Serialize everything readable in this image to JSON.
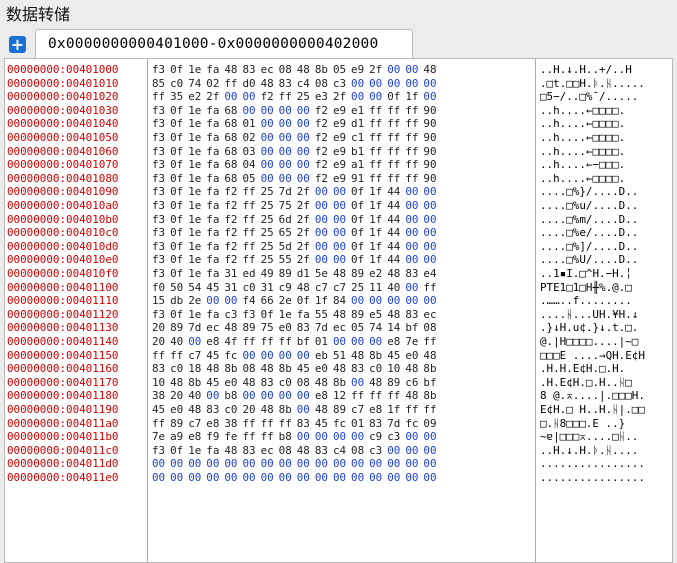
{
  "window": {
    "title": "数据转储"
  },
  "toolbar": {
    "add_icon": "plus-icon"
  },
  "tab": {
    "label": "0x0000000000401000-0x0000000000402000"
  },
  "dump": {
    "rows": [
      {
        "addr": "00000000:00401000",
        "hex": [
          "f3",
          "0f",
          "1e",
          "fa",
          "48",
          "83",
          "ec",
          "08",
          "48",
          "8b",
          "05",
          "e9",
          "2f",
          "00",
          "00",
          "48"
        ],
        "ascii": "..H.↓.H..+/..H"
      },
      {
        "addr": "00000000:00401010",
        "hex": [
          "85",
          "c0",
          "74",
          "02",
          "ff",
          "d0",
          "48",
          "83",
          "c4",
          "08",
          "c3",
          "00",
          "00",
          "00",
          "00",
          "00"
        ],
        "ascii": ".□t.□□H.ᚦ.ᚺ....."
      },
      {
        "addr": "00000000:00401020",
        "hex": [
          "ff",
          "35",
          "e2",
          "2f",
          "00",
          "00",
          "f2",
          "ff",
          "25",
          "e3",
          "2f",
          "00",
          "00",
          "0f",
          "1f",
          "00"
        ],
        "ascii": "□5−/..□%¯/....."
      },
      {
        "addr": "00000000:00401030",
        "hex": [
          "f3",
          "0f",
          "1e",
          "fa",
          "68",
          "00",
          "00",
          "00",
          "00",
          "f2",
          "e9",
          "e1",
          "ff",
          "ff",
          "ff",
          "90"
        ],
        "ascii": "..h....←□□□□."
      },
      {
        "addr": "00000000:00401040",
        "hex": [
          "f3",
          "0f",
          "1e",
          "fa",
          "68",
          "01",
          "00",
          "00",
          "00",
          "f2",
          "e9",
          "d1",
          "ff",
          "ff",
          "ff",
          "90"
        ],
        "ascii": "..h....←□□□□."
      },
      {
        "addr": "00000000:00401050",
        "hex": [
          "f3",
          "0f",
          "1e",
          "fa",
          "68",
          "02",
          "00",
          "00",
          "00",
          "f2",
          "e9",
          "c1",
          "ff",
          "ff",
          "ff",
          "90"
        ],
        "ascii": "..h....←□□□□."
      },
      {
        "addr": "00000000:00401060",
        "hex": [
          "f3",
          "0f",
          "1e",
          "fa",
          "68",
          "03",
          "00",
          "00",
          "00",
          "f2",
          "e9",
          "b1",
          "ff",
          "ff",
          "ff",
          "90"
        ],
        "ascii": "..h....←□□□□."
      },
      {
        "addr": "00000000:00401070",
        "hex": [
          "f3",
          "0f",
          "1e",
          "fa",
          "68",
          "04",
          "00",
          "00",
          "00",
          "f2",
          "e9",
          "a1",
          "ff",
          "ff",
          "ff",
          "90"
        ],
        "ascii": "..h....←−□□□."
      },
      {
        "addr": "00000000:00401080",
        "hex": [
          "f3",
          "0f",
          "1e",
          "fa",
          "68",
          "05",
          "00",
          "00",
          "00",
          "f2",
          "e9",
          "91",
          "ff",
          "ff",
          "ff",
          "90"
        ],
        "ascii": "..h....←□□□□."
      },
      {
        "addr": "00000000:00401090",
        "hex": [
          "f3",
          "0f",
          "1e",
          "fa",
          "f2",
          "ff",
          "25",
          "7d",
          "2f",
          "00",
          "00",
          "0f",
          "1f",
          "44",
          "00",
          "00"
        ],
        "ascii": "....□%}/....D.."
      },
      {
        "addr": "00000000:004010a0",
        "hex": [
          "f3",
          "0f",
          "1e",
          "fa",
          "f2",
          "ff",
          "25",
          "75",
          "2f",
          "00",
          "00",
          "0f",
          "1f",
          "44",
          "00",
          "00"
        ],
        "ascii": "....□%u/....D.."
      },
      {
        "addr": "00000000:004010b0",
        "hex": [
          "f3",
          "0f",
          "1e",
          "fa",
          "f2",
          "ff",
          "25",
          "6d",
          "2f",
          "00",
          "00",
          "0f",
          "1f",
          "44",
          "00",
          "00"
        ],
        "ascii": "....□%m/....D.."
      },
      {
        "addr": "00000000:004010c0",
        "hex": [
          "f3",
          "0f",
          "1e",
          "fa",
          "f2",
          "ff",
          "25",
          "65",
          "2f",
          "00",
          "00",
          "0f",
          "1f",
          "44",
          "00",
          "00"
        ],
        "ascii": "....□%e/....D.."
      },
      {
        "addr": "00000000:004010d0",
        "hex": [
          "f3",
          "0f",
          "1e",
          "fa",
          "f2",
          "ff",
          "25",
          "5d",
          "2f",
          "00",
          "00",
          "0f",
          "1f",
          "44",
          "00",
          "00"
        ],
        "ascii": "....□%]/....D.."
      },
      {
        "addr": "00000000:004010e0",
        "hex": [
          "f3",
          "0f",
          "1e",
          "fa",
          "f2",
          "ff",
          "25",
          "55",
          "2f",
          "00",
          "00",
          "0f",
          "1f",
          "44",
          "00",
          "00"
        ],
        "ascii": "....□%U/....D.."
      },
      {
        "addr": "00000000:004010f0",
        "hex": [
          "f3",
          "0f",
          "1e",
          "fa",
          "31",
          "ed",
          "49",
          "89",
          "d1",
          "5e",
          "48",
          "89",
          "e2",
          "48",
          "83",
          "e4"
        ],
        "ascii": "..1▪I.□^H.−H.╎"
      },
      {
        "addr": "00000000:00401100",
        "hex": [
          "f0",
          "50",
          "54",
          "45",
          "31",
          "c0",
          "31",
          "c9",
          "48",
          "c7",
          "c7",
          "25",
          "11",
          "40",
          "00",
          "ff"
        ],
        "ascii": "PTE1□1□H╫%.@.□"
      },
      {
        "addr": "00000000:00401110",
        "hex": [
          "15",
          "db",
          "2e",
          "00",
          "00",
          "f4",
          "66",
          "2e",
          "0f",
          "1f",
          "84",
          "00",
          "00",
          "00",
          "00",
          "00"
        ],
        "ascii": ".……..f........"
      },
      {
        "addr": "00000000:00401120",
        "hex": [
          "f3",
          "0f",
          "1e",
          "fa",
          "c3",
          "f3",
          "0f",
          "1e",
          "fa",
          "55",
          "48",
          "89",
          "e5",
          "48",
          "83",
          "ec"
        ],
        "ascii": "....ᚺ...UH.¥H.↓"
      },
      {
        "addr": "00000000:00401130",
        "hex": [
          "20",
          "89",
          "7d",
          "ec",
          "48",
          "89",
          "75",
          "e0",
          "83",
          "7d",
          "ec",
          "05",
          "74",
          "14",
          "bf",
          "08"
        ],
        "ascii": ".}↓H.u¢.}↓.t.□."
      },
      {
        "addr": "00000000:00401140",
        "hex": [
          "20",
          "40",
          "00",
          "e8",
          "4f",
          "ff",
          "ff",
          "ff",
          "bf",
          "01",
          "00",
          "00",
          "00",
          "e8",
          "7e",
          "ff"
        ],
        "ascii": "@.|H□□□□....|~□"
      },
      {
        "addr": "00000000:00401150",
        "hex": [
          "ff",
          "ff",
          "c7",
          "45",
          "fc",
          "00",
          "00",
          "00",
          "00",
          "eb",
          "51",
          "48",
          "8b",
          "45",
          "e0",
          "48"
        ],
        "ascii": "□□□E ....→QH.E¢H"
      },
      {
        "addr": "00000000:00401160",
        "hex": [
          "83",
          "c0",
          "18",
          "48",
          "8b",
          "08",
          "48",
          "8b",
          "45",
          "e0",
          "48",
          "83",
          "c0",
          "10",
          "48",
          "8b"
        ],
        "ascii": ".H.H.E¢H.□.H."
      },
      {
        "addr": "00000000:00401170",
        "hex": [
          "10",
          "48",
          "8b",
          "45",
          "e0",
          "48",
          "83",
          "c0",
          "08",
          "48",
          "8b",
          "00",
          "48",
          "89",
          "c6",
          "bf"
        ],
        "ascii": ".H.E¢H.□.H..ᚺ□"
      },
      {
        "addr": "00000000:00401180",
        "hex": [
          "38",
          "20",
          "40",
          "00",
          "b8",
          "00",
          "00",
          "00",
          "00",
          "e8",
          "12",
          "ff",
          "ff",
          "ff",
          "48",
          "8b"
        ],
        "ascii": "8 @.⌅....|.□□□H."
      },
      {
        "addr": "00000000:00401190",
        "hex": [
          "45",
          "e0",
          "48",
          "83",
          "c0",
          "20",
          "48",
          "8b",
          "00",
          "48",
          "89",
          "c7",
          "e8",
          "1f",
          "ff",
          "ff"
        ],
        "ascii": "E¢H.□ H..H.ᚺ|.□□"
      },
      {
        "addr": "00000000:004011a0",
        "hex": [
          "ff",
          "89",
          "c7",
          "e8",
          "38",
          "ff",
          "ff",
          "ff",
          "83",
          "45",
          "fc",
          "01",
          "83",
          "7d",
          "fc",
          "09"
        ],
        "ascii": "□.ᚺ8□□□.E ..}"
      },
      {
        "addr": "00000000:004011b0",
        "hex": [
          "7e",
          "a9",
          "e8",
          "f9",
          "fe",
          "ff",
          "ff",
          "b8",
          "00",
          "00",
          "00",
          "00",
          "c9",
          "c3",
          "00",
          "00"
        ],
        "ascii": "~ɐ|□□□⌅....□ᚺ.."
      },
      {
        "addr": "00000000:004011c0",
        "hex": [
          "f3",
          "0f",
          "1e",
          "fa",
          "48",
          "83",
          "ec",
          "08",
          "48",
          "83",
          "c4",
          "08",
          "c3",
          "00",
          "00",
          "00"
        ],
        "ascii": "..H.↓.H.ᚦ.ᚺ...."
      },
      {
        "addr": "00000000:004011d0",
        "hex": [
          "00",
          "00",
          "00",
          "00",
          "00",
          "00",
          "00",
          "00",
          "00",
          "00",
          "00",
          "00",
          "00",
          "00",
          "00",
          "00"
        ],
        "ascii": "................"
      },
      {
        "addr": "00000000:004011e0",
        "hex": [
          "00",
          "00",
          "00",
          "00",
          "00",
          "00",
          "00",
          "00",
          "00",
          "00",
          "00",
          "00",
          "00",
          "00",
          "00",
          "00"
        ],
        "ascii": "................"
      }
    ]
  }
}
